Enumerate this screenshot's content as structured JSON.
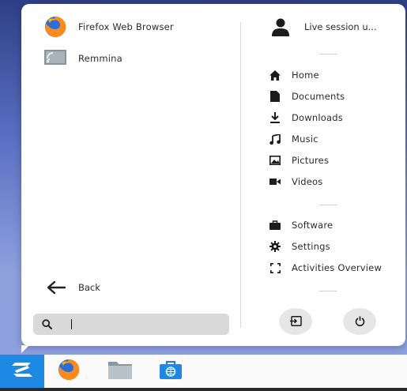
{
  "apps": [
    {
      "label": "Firefox Web Browser",
      "icon": "firefox-icon"
    },
    {
      "label": "Remmina",
      "icon": "remmina-icon"
    }
  ],
  "user": {
    "label": "Live session u...",
    "icon": "user-icon"
  },
  "places": [
    {
      "label": "Home",
      "icon": "home-icon"
    },
    {
      "label": "Documents",
      "icon": "documents-icon"
    },
    {
      "label": "Downloads",
      "icon": "downloads-icon"
    },
    {
      "label": "Music",
      "icon": "music-icon"
    },
    {
      "label": "Pictures",
      "icon": "pictures-icon"
    },
    {
      "label": "Videos",
      "icon": "videos-icon"
    }
  ],
  "system": [
    {
      "label": "Software",
      "icon": "software-icon"
    },
    {
      "label": "Settings",
      "icon": "settings-icon"
    },
    {
      "label": "Activities Overview",
      "icon": "activities-overview-icon"
    }
  ],
  "back": {
    "label": "Back",
    "icon": "back-arrow-icon"
  },
  "search": {
    "value": "",
    "icon": "search-icon"
  },
  "actions": [
    {
      "icon": "logout-icon"
    },
    {
      "icon": "power-icon"
    }
  ],
  "taskbar": {
    "start_icon": "zorin-start-icon",
    "apps": [
      "firefox-icon",
      "files-icon",
      "software-store-icon"
    ]
  },
  "colors": {
    "accent": "#1e88e5",
    "menu_bg": "#ffffff",
    "search_bg": "#d9d9d9"
  }
}
